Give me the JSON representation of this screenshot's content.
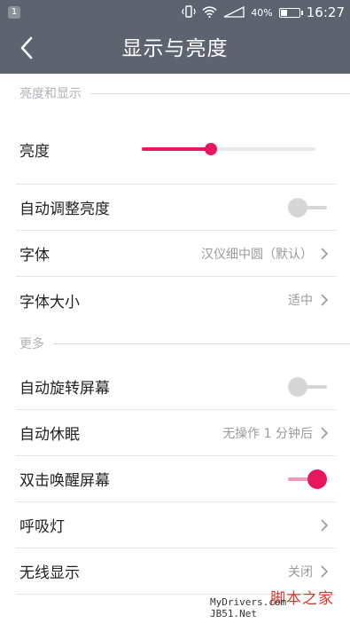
{
  "status_bar": {
    "notification_count": "1",
    "battery_percent": "40%",
    "battery_level": 0.4,
    "time": "16:27",
    "icons": [
      "vibrate-icon",
      "wifi-icon",
      "signal-icon",
      "battery-icon"
    ]
  },
  "header": {
    "title": "显示与亮度",
    "back_icon": "back-arrow-icon"
  },
  "sections": {
    "display": {
      "title": "亮度和显示"
    },
    "more": {
      "title": "更多"
    }
  },
  "brightness": {
    "label": "亮度",
    "level": 0.4
  },
  "auto_brightness": {
    "label": "自动调整亮度",
    "enabled": false
  },
  "font": {
    "label": "字体",
    "value": "汉仪细中圆（默认）"
  },
  "font_size": {
    "label": "字体大小",
    "value": "适中"
  },
  "auto_rotate": {
    "label": "自动旋转屏幕",
    "enabled": false
  },
  "auto_sleep": {
    "label": "自动休眠",
    "value": "无操作 1 分钟后"
  },
  "double_tap_wake": {
    "label": "双击唤醒屏幕",
    "enabled": true
  },
  "breathing_light": {
    "label": "呼吸灯"
  },
  "wireless_display": {
    "label": "无线显示",
    "value": "关闭"
  },
  "watermark": {
    "brand": "脚本之家",
    "url": "MyDrivers.com JB51.Net"
  },
  "colors": {
    "bar_bg": "#5d6470",
    "accent": "#e8175d",
    "accent_track": "#f09ab8",
    "toggle_off_knob": "#d6d6d6",
    "toggle_off_track": "#d6d6d6"
  }
}
